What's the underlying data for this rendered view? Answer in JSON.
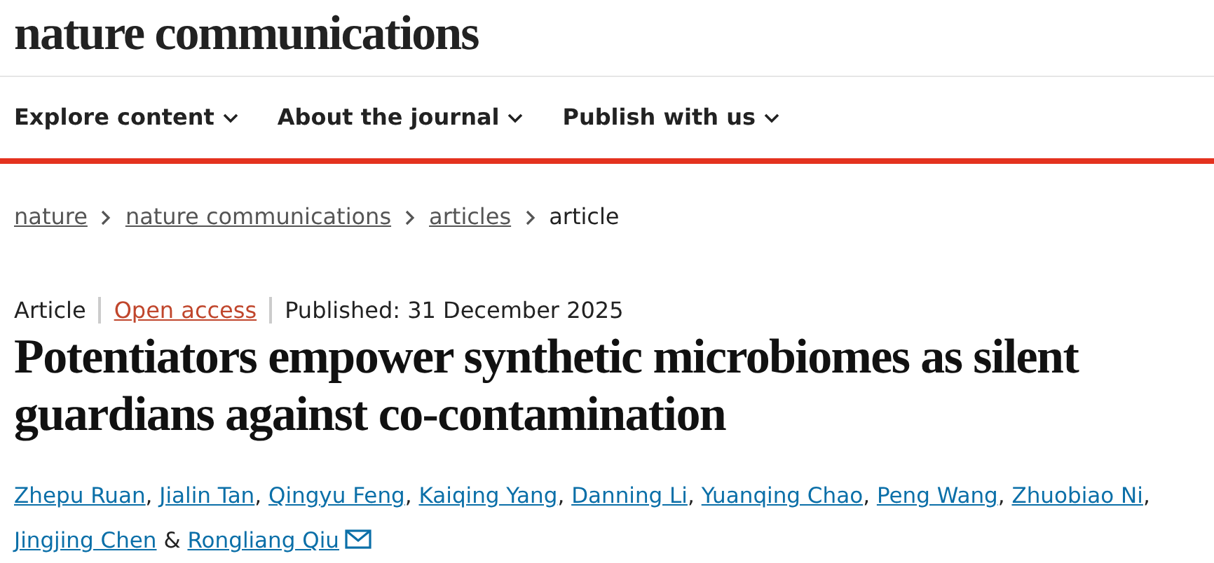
{
  "logo": "nature communications",
  "nav": [
    {
      "label": "Explore content"
    },
    {
      "label": "About the journal"
    },
    {
      "label": "Publish with us"
    }
  ],
  "breadcrumb": [
    {
      "label": "nature",
      "link": true
    },
    {
      "label": "nature communications",
      "link": true
    },
    {
      "label": "articles",
      "link": true
    },
    {
      "label": "article",
      "link": false
    }
  ],
  "meta": [
    {
      "kind": "type",
      "text": "Article"
    },
    {
      "kind": "access",
      "text": "Open access"
    },
    {
      "kind": "date",
      "text": "Published: 31 December 2025"
    }
  ],
  "title": "Potentiators empower synthetic microbiomes as silent guardians against co-contamination",
  "authors": [
    {
      "name": "Zhepu Ruan",
      "separator": ",",
      "email": false
    },
    {
      "name": "Jialin Tan",
      "separator": ",",
      "email": false
    },
    {
      "name": "Qingyu Feng",
      "separator": ",",
      "email": false
    },
    {
      "name": "Kaiqing Yang",
      "separator": ",",
      "email": false
    },
    {
      "name": "Danning Li",
      "separator": ",",
      "email": false
    },
    {
      "name": "Yuanqing Chao",
      "separator": ",",
      "email": false
    },
    {
      "name": "Peng Wang",
      "separator": ",",
      "email": false
    },
    {
      "name": "Zhuobiao Ni",
      "separator": ",",
      "email": false
    },
    {
      "name": "Jingjing Chen",
      "separator": "&",
      "email": false
    },
    {
      "name": "Rongliang Qiu",
      "email": true
    }
  ]
}
